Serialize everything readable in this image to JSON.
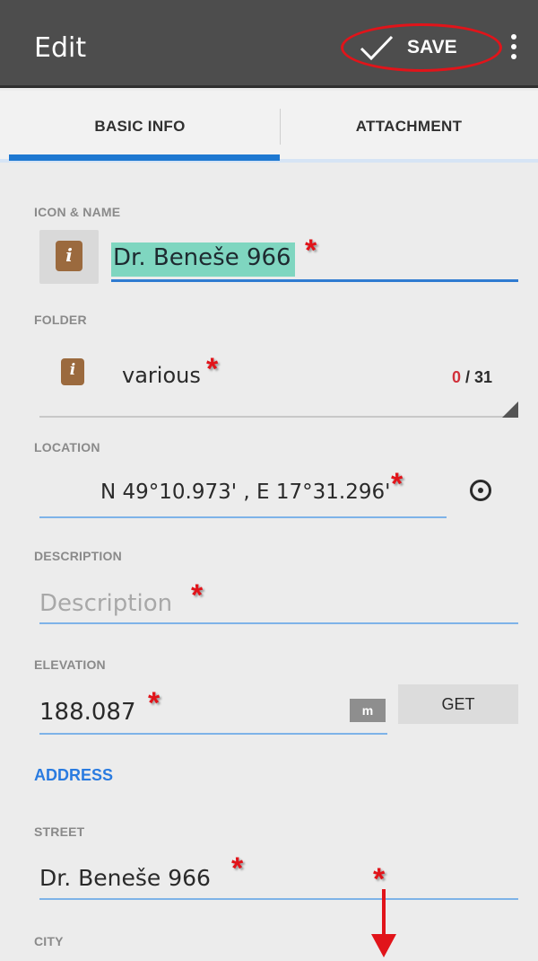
{
  "appbar": {
    "title": "Edit",
    "save_label": "SAVE"
  },
  "tabs": [
    {
      "label": "BASIC INFO",
      "active": true
    },
    {
      "label": "ATTACHMENT",
      "active": false
    }
  ],
  "icon_name": {
    "label": "ICON & NAME",
    "value": "Dr. Beneše 966",
    "icon": "info-poi-icon"
  },
  "folder": {
    "label": "FOLDER",
    "value": "various",
    "count_current": "0",
    "count_sep": " / ",
    "count_total": "31"
  },
  "location": {
    "label": "LOCATION",
    "value": "N 49°10.973' , E 17°31.296'"
  },
  "description": {
    "label": "DESCRIPTION",
    "placeholder": "Description"
  },
  "elevation": {
    "label": "ELEVATION",
    "value": "188.087",
    "unit": "m",
    "get_label": "GET"
  },
  "address": {
    "header": "ADDRESS",
    "street_label": "STREET",
    "street_value": "Dr. Beneše 966",
    "city_label": "CITY"
  },
  "annotations": {
    "star": "*"
  },
  "colors": {
    "appbar": "#4d4d4d",
    "accent": "#1e78d1",
    "annotation": "#e1141a",
    "name_highlight": "#7fd6c0",
    "poi_icon": "#9b6a3e"
  }
}
